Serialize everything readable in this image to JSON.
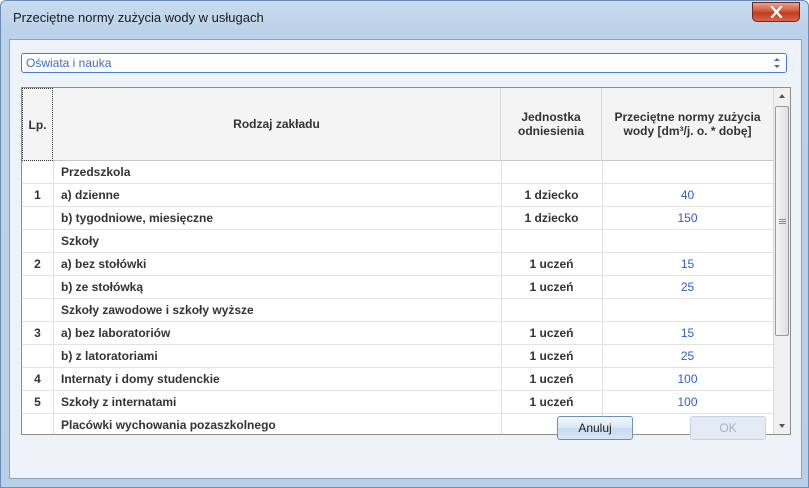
{
  "window": {
    "title": "Przeciętne normy zużycia wody w usługach"
  },
  "combo": {
    "value": "Oświata i nauka"
  },
  "table": {
    "headers": {
      "lp": "Lp.",
      "name": "Rodzaj zakładu",
      "unit": "Jednostka odniesienia",
      "norm": "Przeciętne normy zużycia wody [dm³/j. o. * dobę]"
    },
    "rows": [
      {
        "lp": "",
        "name": "Przedszkola",
        "unit": "",
        "norm": ""
      },
      {
        "lp": "1",
        "name": "a) dzienne",
        "unit": "1 dziecko",
        "norm": "40"
      },
      {
        "lp": "",
        "name": "b) tygodniowe, miesięczne",
        "unit": "1 dziecko",
        "norm": "150"
      },
      {
        "lp": "",
        "name": "Szkoły",
        "unit": "",
        "norm": ""
      },
      {
        "lp": "2",
        "name": "a) bez stołówki",
        "unit": "1 uczeń",
        "norm": "15"
      },
      {
        "lp": "",
        "name": "b) ze stołówką",
        "unit": "1 uczeń",
        "norm": "25"
      },
      {
        "lp": "",
        "name": "Szkoły zawodowe i szkoły wyższe",
        "unit": "",
        "norm": ""
      },
      {
        "lp": "3",
        "name": "a) bez laboratoriów",
        "unit": "1 uczeń",
        "norm": "15"
      },
      {
        "lp": "",
        "name": "b) z latoratoriami",
        "unit": "1 uczeń",
        "norm": "25"
      },
      {
        "lp": "4",
        "name": "Internaty i domy studenckie",
        "unit": "1 uczeń",
        "norm": "100"
      },
      {
        "lp": "5",
        "name": "Szkoły z internatami",
        "unit": "1 uczeń",
        "norm": "100"
      },
      {
        "lp": "",
        "name": "Placówki wychowania pozaszkolnego",
        "unit": "",
        "norm": ""
      }
    ]
  },
  "buttons": {
    "cancel": "Anuluj",
    "ok": "OK"
  }
}
